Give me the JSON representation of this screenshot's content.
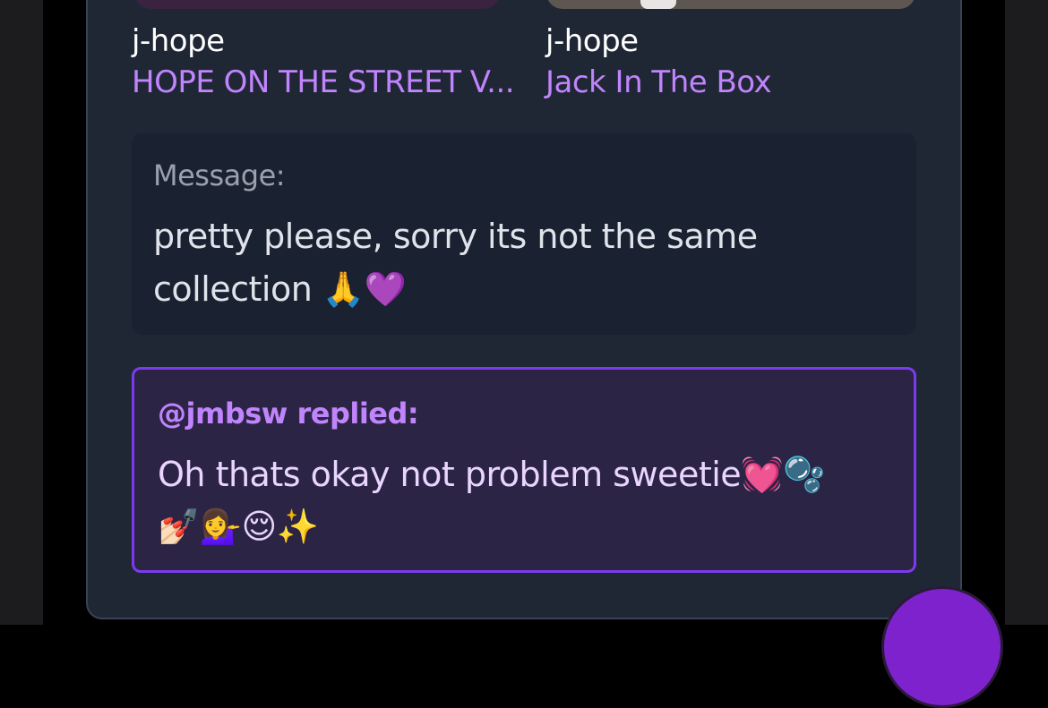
{
  "tracks": [
    {
      "artist": "j-hope",
      "title": "HOPE ON THE STREET V..."
    },
    {
      "artist": "j-hope",
      "title": "Jack In The Box"
    }
  ],
  "message": {
    "label": "Message:",
    "text": "pretty please, sorry its not the same collection 🙏💜"
  },
  "reply": {
    "label": "@jmbsw replied:",
    "text": "Oh thats okay not problem sweetie💓🫧 💅🏻💁‍♀️😌✨"
  },
  "colors": {
    "card": "#1f2735",
    "accent": "#c084fc",
    "reply_border": "#7c3aed",
    "fab": "#7e22ce"
  }
}
